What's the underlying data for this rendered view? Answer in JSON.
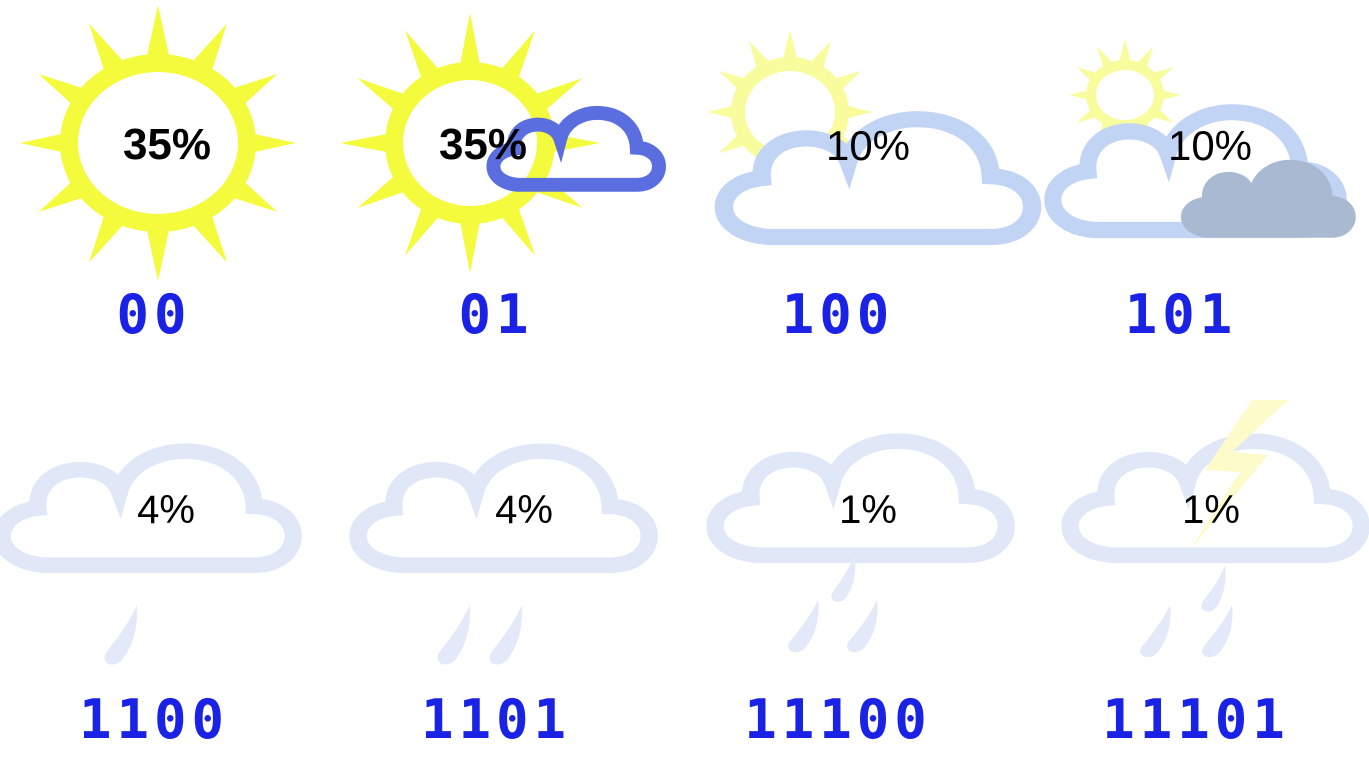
{
  "colors": {
    "sun": "#f4fa3c",
    "cloud_outline_bright": "#5a6ee0",
    "cloud_outline_light": "#c2d4f4",
    "cloud_outline_faint": "#e0e8f8",
    "dark_cloud_fill": "#aab9d2",
    "raindrop": "#e3e9f8",
    "lightning": "#fdfbc9",
    "code_text": "#1a22e6",
    "percent_text": "#000000"
  },
  "symbols": [
    {
      "icon": "sun-icon",
      "probability": "35%",
      "code": "00"
    },
    {
      "icon": "sun-with-small-cloud-icon",
      "probability": "35%",
      "code": "01"
    },
    {
      "icon": "cloud-with-faint-sun-icon",
      "probability": "10%",
      "code": "100"
    },
    {
      "icon": "cloud-with-dark-cloud-icon",
      "probability": "10%",
      "code": "101"
    },
    {
      "icon": "cloud-with-one-raindrop-icon",
      "probability": "4%",
      "code": "1100"
    },
    {
      "icon": "cloud-with-two-raindrops-icon",
      "probability": "4%",
      "code": "1101"
    },
    {
      "icon": "cloud-with-three-raindrops-icon",
      "probability": "1%",
      "code": "11100"
    },
    {
      "icon": "cloud-with-lightning-and-rain-icon",
      "probability": "1%",
      "code": "11101"
    }
  ]
}
